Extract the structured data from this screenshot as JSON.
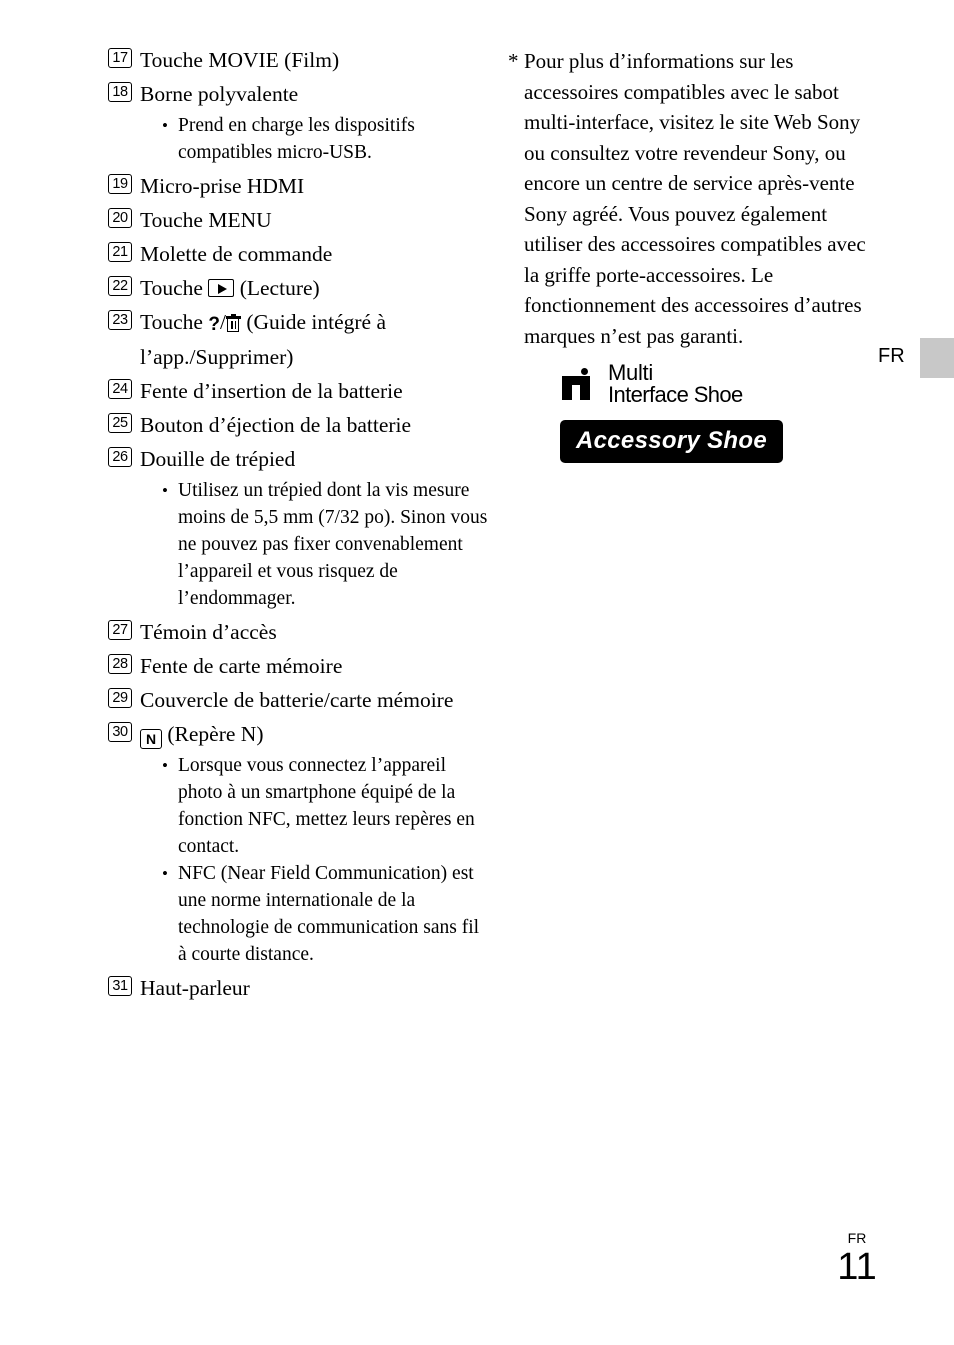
{
  "document": {
    "language_tab": "FR",
    "footer": {
      "lang": "FR",
      "page_number": "11"
    }
  },
  "left_column": {
    "items": [
      {
        "num": "17",
        "text": "Touche MOVIE (Film)",
        "bullets": []
      },
      {
        "num": "18",
        "text": "Borne polyvalente",
        "bullets": [
          "Prend en charge les dispositifs compatibles micro-USB."
        ]
      },
      {
        "num": "19",
        "text": "Micro-prise HDMI",
        "bullets": []
      },
      {
        "num": "20",
        "text": "Touche MENU",
        "bullets": []
      },
      {
        "num": "21",
        "text": "Molette de commande",
        "bullets": []
      },
      {
        "num": "22",
        "text_before": "Touche",
        "icon": "play-icon",
        "text_after": "(Lecture)",
        "bullets": []
      },
      {
        "num": "23",
        "text_before": "Touche",
        "icon": "question-trash-icon",
        "text_after": "(Guide intégré à l’app./Supprimer)",
        "bullets": []
      },
      {
        "num": "24",
        "text": "Fente d’insertion de la batterie",
        "bullets": []
      },
      {
        "num": "25",
        "text": "Bouton d’éjection de la batterie",
        "bullets": []
      },
      {
        "num": "26",
        "text": "Douille de trépied",
        "bullets": [
          "Utilisez un trépied dont la vis mesure moins de 5,5 mm (7/32 po). Sinon vous ne pouvez pas fixer convenablement l’appareil et vous risquez de l’endommager."
        ]
      },
      {
        "num": "27",
        "text": "Témoin d’accès",
        "bullets": []
      },
      {
        "num": "28",
        "text": "Fente de carte mémoire",
        "bullets": []
      },
      {
        "num": "29",
        "text": "Couvercle de batterie/carte mémoire",
        "bullets": []
      },
      {
        "num": "30",
        "text_before": "",
        "icon": "n-mark-icon",
        "text_after": "(Repère N)",
        "bullets": [
          "Lorsque vous connectez l’appareil photo à un smartphone équipé de la fonction NFC, mettez leurs repères en contact.",
          "NFC (Near Field Communication) est une norme internationale de la technologie de communication sans fil à courte distance."
        ]
      },
      {
        "num": "31",
        "text": "Haut-parleur",
        "bullets": []
      }
    ],
    "icon_labels": {
      "question": "?",
      "slash": "/",
      "n_mark": "N"
    }
  },
  "right_column": {
    "note_star": "*",
    "note_text": "Pour plus d’informations sur les accessoires compatibles avec le sabot multi-interface, visitez le site Web Sony ou consultez votre revendeur Sony, ou encore un centre de service après-vente Sony agréé. Vous pouvez également utiliser des accessoires compatibles avec la griffe porte-accessoires. Le fonctionnement des accessoires d’autres marques n’est pas garanti.",
    "logos": {
      "multi_interface_line1": "Multi",
      "multi_interface_line2": "Interface Shoe",
      "accessory_shoe": "Accessory Shoe"
    }
  }
}
